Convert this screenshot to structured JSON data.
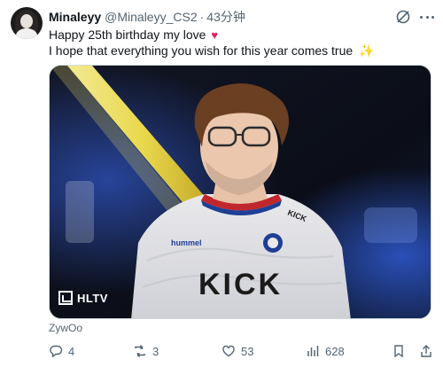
{
  "tweet": {
    "display_name": "Minaleyy",
    "handle": "@Minaleyy_CS2",
    "separator": "·",
    "time": "43分钟",
    "text_line1": "Happy 25th birthday my love",
    "text_line1_emoji": "♥",
    "text_line2": "I hope that everything you wish for this year comes true",
    "text_line2_emoji": "✨",
    "media": {
      "watermark": "HLTV",
      "jersey_brand": "hummel",
      "jersey_sponsor": "KICK",
      "collar_text": "KICK"
    },
    "caption": "ZywOo"
  },
  "actions": {
    "replies": "4",
    "reposts": "3",
    "likes": "53",
    "views": "628"
  },
  "colors": {
    "muted": "#536471",
    "text": "#0f1419",
    "heart": "#e0245e",
    "sparkle": "#f7c948"
  },
  "icons": [
    "grok-icon",
    "more-icon",
    "reply-icon",
    "repost-icon",
    "like-icon",
    "views-icon",
    "bookmark-icon",
    "share-icon"
  ]
}
